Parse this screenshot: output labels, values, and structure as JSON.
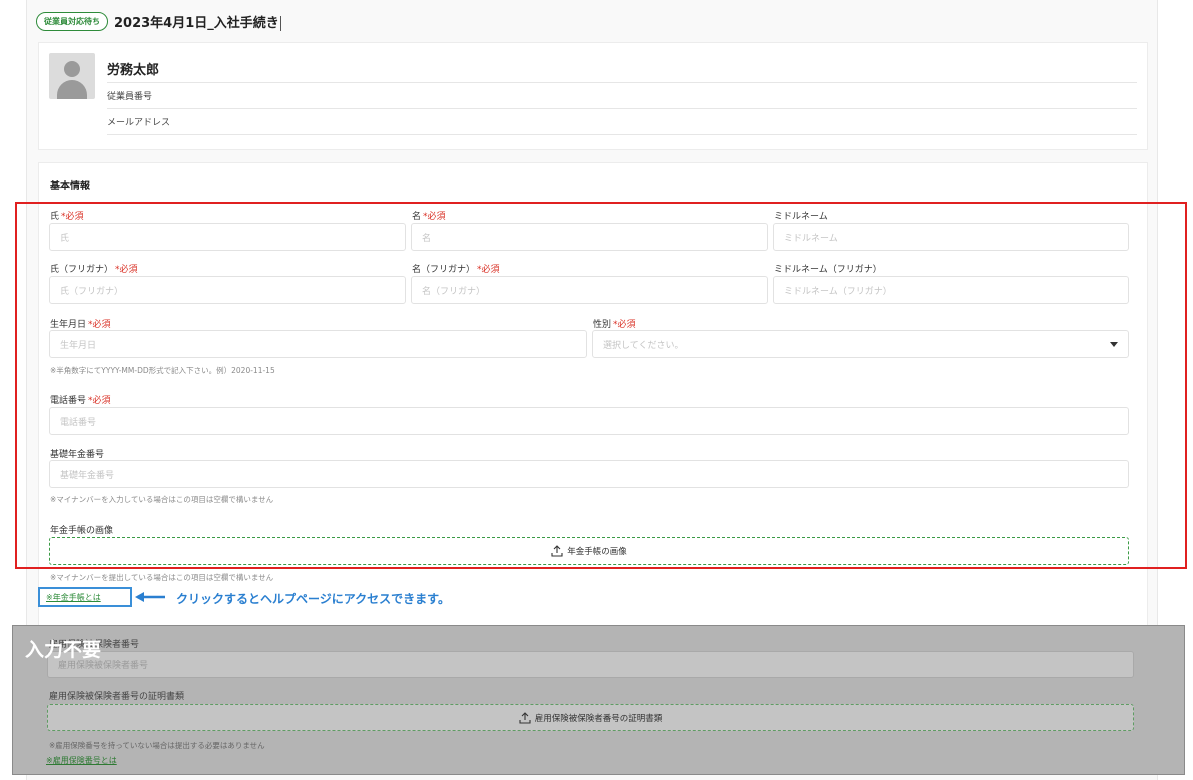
{
  "header": {
    "status_badge": "従業員対応待ち",
    "title": "2023年4月1日_入社手続き"
  },
  "profile": {
    "name": "労務太郎",
    "employee_number_label": "従業員番号",
    "email_label": "メールアドレス"
  },
  "basic_info": {
    "section_title": "基本情報",
    "required_mark": "*必須",
    "fields": {
      "last_name": {
        "label": "氏",
        "placeholder": "氏"
      },
      "first_name": {
        "label": "名",
        "placeholder": "名"
      },
      "middle_name": {
        "label": "ミドルネーム",
        "placeholder": "ミドルネーム"
      },
      "last_name_kana": {
        "label": "氏（フリガナ）",
        "placeholder": "氏（フリガナ）"
      },
      "first_name_kana": {
        "label": "名（フリガナ）",
        "placeholder": "名（フリガナ）"
      },
      "middle_name_kana": {
        "label": "ミドルネーム（フリガナ）",
        "placeholder": "ミドルネーム（フリガナ）"
      },
      "birthdate": {
        "label": "生年月日",
        "placeholder": "生年月日",
        "hint": "※半角数字にてYYYY-MM-DD形式で記入下さい。例）2020-11-15"
      },
      "gender": {
        "label": "性別",
        "placeholder": "選択してください。"
      },
      "phone": {
        "label": "電話番号",
        "placeholder": "電話番号"
      },
      "pension_number": {
        "label": "基礎年金番号",
        "placeholder": "基礎年金番号",
        "hint": "※マイナンバーを入力している場合はこの項目は空欄で構いません"
      },
      "pension_book_image": {
        "label": "年金手帳の画像",
        "button": "年金手帳の画像",
        "hint": "※マイナンバーを提出している場合はこの項目は空欄で構いません"
      }
    },
    "help_link": "※年金手帳とは",
    "callout": "クリックするとヘルプページにアクセスできます。"
  },
  "employment_insurance": {
    "overlay_label": "入力不要",
    "number_label": "雇用保険被保険者番号",
    "number_placeholder": "雇用保険被保険者番号",
    "doc_label": "雇用保険被保険者番号の証明書類",
    "doc_button": "雇用保険被保険者番号の証明書類",
    "hint": "※雇用保険番号を持っていない場合は提出する必要はありません",
    "link": "※雇用保険番号とは"
  },
  "colors": {
    "accent_green": "#2e8b3a",
    "required_red": "#d93025",
    "highlight_red": "#e02020",
    "highlight_blue": "#3a8fd8",
    "overlay_gray": "#b4b4b4"
  }
}
